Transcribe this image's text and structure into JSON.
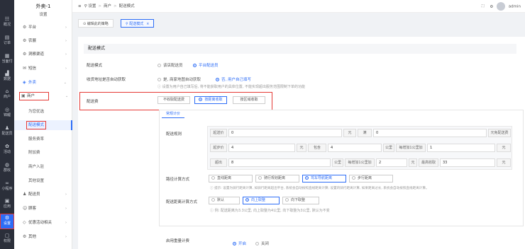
{
  "rail": [
    {
      "label": "概况",
      "icon": "grid-icon",
      "glyph": "☷"
    },
    {
      "label": "订单",
      "icon": "order-icon",
      "glyph": "▤"
    },
    {
      "label": "当面付",
      "icon": "pay-icon",
      "glyph": "▦"
    },
    {
      "label": "数据",
      "icon": "chart-icon",
      "glyph": "▟"
    },
    {
      "label": "商户",
      "icon": "store-icon",
      "glyph": "⌂"
    },
    {
      "label": "锦鲤",
      "icon": "fish-icon",
      "glyph": "◎"
    },
    {
      "label": "配送员",
      "icon": "rider-icon",
      "glyph": "♟"
    },
    {
      "label": "活动",
      "icon": "activity-icon",
      "glyph": "✿"
    },
    {
      "label": "群收",
      "icon": "collect-icon",
      "glyph": "◍"
    },
    {
      "label": "小程序",
      "icon": "miniapp-icon",
      "glyph": "∞"
    },
    {
      "label": "应用",
      "icon": "apps-icon",
      "glyph": "▣"
    },
    {
      "label": "设置",
      "icon": "settings-icon",
      "glyph": "⚙"
    },
    {
      "label": "权限",
      "icon": "permission-icon",
      "glyph": "▢"
    }
  ],
  "sidebar": {
    "title": "外卖-1",
    "subtitle": "设置",
    "items": [
      {
        "label": "平台",
        "icon": "gear-icon"
      },
      {
        "label": "农展",
        "icon": "gear-icon"
      },
      {
        "label": "洞察渠道",
        "icon": "gear-icon"
      },
      {
        "label": "短信",
        "icon": "message-icon"
      },
      {
        "label": "外卖",
        "icon": "takeout-icon"
      },
      {
        "label": "商户",
        "icon": "store-icon"
      }
    ],
    "sub": [
      "为您优选",
      "配送模式",
      "服务费率",
      "附加费",
      "商户入驻",
      "其他设置"
    ],
    "tail": [
      {
        "label": "配送员",
        "icon": "rider-icon"
      },
      {
        "label": "顾客",
        "icon": "user-icon"
      },
      {
        "label": "优惠活动相关",
        "icon": "coupon-icon"
      },
      {
        "label": "其他",
        "icon": "gear-icon"
      }
    ]
  },
  "topbar": {
    "crumbs": [
      "设置",
      "商户",
      "配送模式"
    ],
    "admin": "admin"
  },
  "tabs": [
    "编辑此的策略",
    "配送模式"
  ],
  "panel": {
    "title": "配送模式",
    "mode_label": "配送模式",
    "mode_options": [
      "该店配送员",
      "平台配送员"
    ],
    "addr_label": "收货地址是否自动获取",
    "addr_options": [
      "是, 商家地图自动获取",
      "否, 用户自己填写"
    ],
    "addr_hint": "设置为用户自己填写后, 将不能获取用户的具体位置, 不能实现超出服务范围限制下单的功能",
    "fee_label": "配送费",
    "fee_options": [
      "不收取配送费",
      "按距离收取",
      "按区域收取"
    ],
    "subtab": "常规计价",
    "rule_label": "配送规则",
    "row1": {
      "start_label": "起送价",
      "start_val": "0",
      "yuan1": "元",
      "full_label": "满",
      "full_val": "0",
      "free_text": "元免配送费"
    },
    "row2": {
      "base_label": "起步价",
      "base_val": "4",
      "yuan": "元",
      "incl_label": "包含",
      "incl_val": "4",
      "km": "公里",
      "perkm_label": "每增加1公里加",
      "perkm_val": "1",
      "yuan2": "元"
    },
    "row3": {
      "over_label": "超出",
      "over_val": "8",
      "km": "公里",
      "perkm_label": "每增加1公里加",
      "perkm_val": "2",
      "yuan": "元",
      "max_label": "最高收取",
      "max_val": "33",
      "yuan2": "元"
    },
    "calc_label": "路径计算方式",
    "calc_options": [
      "直线距离",
      "骑行规划距离",
      "驾车导航距离",
      "步行距离"
    ],
    "calc_hint": "提示: 设置为骑行距离计算, 如骑行距离超出平台, 系统会自动按照直线距离计算; 设置的骑行距离计算, 如果距离过长, 系统会自动按照直线距离计算。",
    "round_label": "配送距离计算方式",
    "round_options": [
      "默认",
      "向上取整",
      "向下取整"
    ],
    "round_hint": "例: 配送距离为3.3公里, 向上取整为4公里, 向下取整为3公里, 默认为不变",
    "weight_label": "启用重量计费",
    "weight_options": [
      "开启",
      "关闭"
    ]
  }
}
